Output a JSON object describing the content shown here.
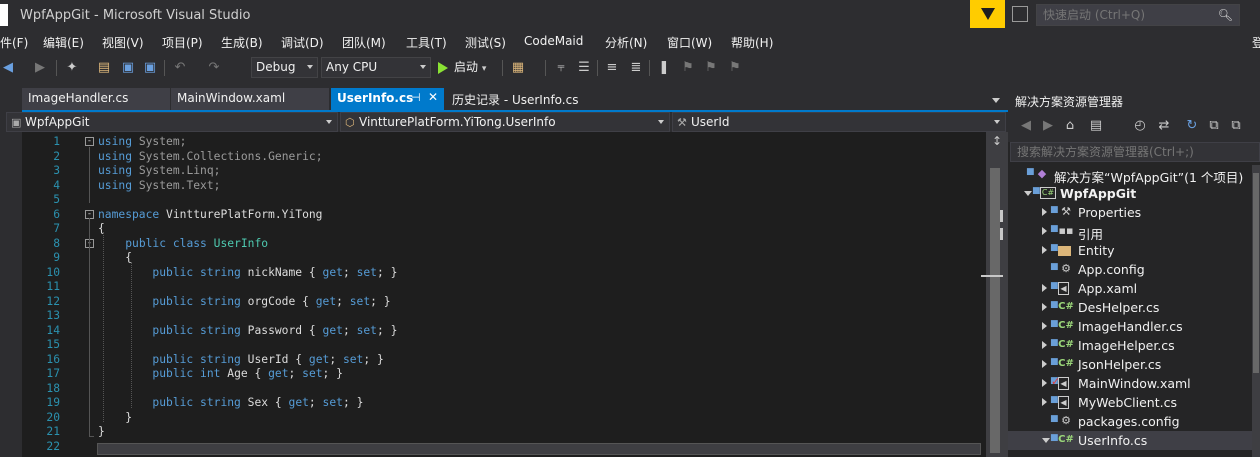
{
  "window": {
    "title": "WpfAppGit - Microsoft Visual Studio"
  },
  "quick_launch": {
    "placeholder": "快速启动 (Ctrl+Q)"
  },
  "menu": [
    "件(F)",
    "编辑(E)",
    "视图(V)",
    "项目(P)",
    "生成(B)",
    "调试(D)",
    "团队(M)",
    "工具(T)",
    "测试(S)",
    "CodeMaid",
    "分析(N)",
    "窗口(W)",
    "帮助(H)"
  ],
  "menu_cut": "登",
  "toolbar": {
    "configuration": "Debug",
    "platform": "Any CPU",
    "start_label": "启动"
  },
  "tabs": [
    {
      "label": "ImageHandler.cs"
    },
    {
      "label": "MainWindow.xaml"
    },
    {
      "label": "UserInfo.cs"
    },
    {
      "label": "历史记录 - UserInfo.cs"
    }
  ],
  "navbar": {
    "project": "WpfAppGit",
    "type": "VintturePlatForm.YiTong.UserInfo",
    "member": "UserId"
  },
  "code_lines": [
    {
      "n": "1",
      "t": "using System;"
    },
    {
      "n": "2",
      "t": "using System.Collections.Generic;"
    },
    {
      "n": "3",
      "t": "using System.Linq;"
    },
    {
      "n": "4",
      "t": "using System.Text;"
    },
    {
      "n": "5",
      "t": ""
    },
    {
      "n": "6",
      "t": "namespace VintturePlatForm.YiTong"
    },
    {
      "n": "7",
      "t": "{"
    },
    {
      "n": "8",
      "t": "    public class UserInfo"
    },
    {
      "n": "9",
      "t": "    {"
    },
    {
      "n": "10",
      "t": "        public string nickName { get; set; }"
    },
    {
      "n": "11",
      "t": ""
    },
    {
      "n": "12",
      "t": "        public string orgCode { get; set; }"
    },
    {
      "n": "13",
      "t": ""
    },
    {
      "n": "14",
      "t": "        public string Password { get; set; }"
    },
    {
      "n": "15",
      "t": ""
    },
    {
      "n": "16",
      "t": "        public string UserId { get; set; }"
    },
    {
      "n": "17",
      "t": "        public int Age { get; set; }"
    },
    {
      "n": "18",
      "t": ""
    },
    {
      "n": "19",
      "t": "        public string Sex { get; set; }"
    },
    {
      "n": "20",
      "t": "    }"
    },
    {
      "n": "21",
      "t": "}"
    },
    {
      "n": "22",
      "t": ""
    }
  ],
  "solution_explorer": {
    "title": "解决方案资源管理器",
    "search_placeholder": "搜索解决方案资源管理器(Ctrl+;)",
    "items": [
      {
        "label": "解决方案“WpfAppGit”(1 个项目)",
        "icon": "solution-icon",
        "level": 0,
        "expander": "none",
        "bold": false
      },
      {
        "label": "WpfAppGit",
        "icon": "csharp-project-icon",
        "level": 1,
        "expander": "expanded",
        "bold": true
      },
      {
        "label": "Properties",
        "icon": "wrench-icon",
        "level": 2,
        "expander": "collapsed",
        "bold": false
      },
      {
        "label": "引用",
        "icon": "references-icon",
        "level": 2,
        "expander": "collapsed",
        "bold": false
      },
      {
        "label": "Entity",
        "icon": "folder-icon",
        "level": 2,
        "expander": "collapsed",
        "bold": false
      },
      {
        "label": "App.config",
        "icon": "config-file-icon",
        "level": 2,
        "expander": "none",
        "bold": false
      },
      {
        "label": "App.xaml",
        "icon": "xaml-file-icon",
        "level": 2,
        "expander": "collapsed",
        "bold": false
      },
      {
        "label": "DesHelper.cs",
        "icon": "csharp-file-icon",
        "level": 2,
        "expander": "collapsed",
        "bold": false
      },
      {
        "label": "ImageHandler.cs",
        "icon": "csharp-file-icon",
        "level": 2,
        "expander": "collapsed",
        "bold": false
      },
      {
        "label": "ImageHelper.cs",
        "icon": "csharp-file-icon",
        "level": 2,
        "expander": "collapsed",
        "bold": false
      },
      {
        "label": "JsonHelper.cs",
        "icon": "csharp-file-icon",
        "level": 2,
        "expander": "collapsed",
        "bold": false
      },
      {
        "label": "MainWindow.xaml",
        "icon": "xaml-file-icon",
        "level": 2,
        "expander": "collapsed",
        "bold": false,
        "modified": true
      },
      {
        "label": "MyWebClient.cs",
        "icon": "xaml-file-icon",
        "level": 2,
        "expander": "collapsed",
        "bold": false
      },
      {
        "label": "packages.config",
        "icon": "config-file-icon",
        "level": 2,
        "expander": "none",
        "bold": false
      },
      {
        "label": "UserInfo.cs",
        "icon": "csharp-file-icon",
        "level": 2,
        "expander": "expanded",
        "bold": false,
        "selected": true
      }
    ]
  },
  "colors": {
    "accent": "#007acc",
    "keyword": "#569cd6",
    "type": "#4ec9b0",
    "line_number": "#2b91af",
    "editor_bg": "#1e1e1e",
    "chrome_bg": "#2d2d30",
    "notify": "#ffcc00"
  }
}
